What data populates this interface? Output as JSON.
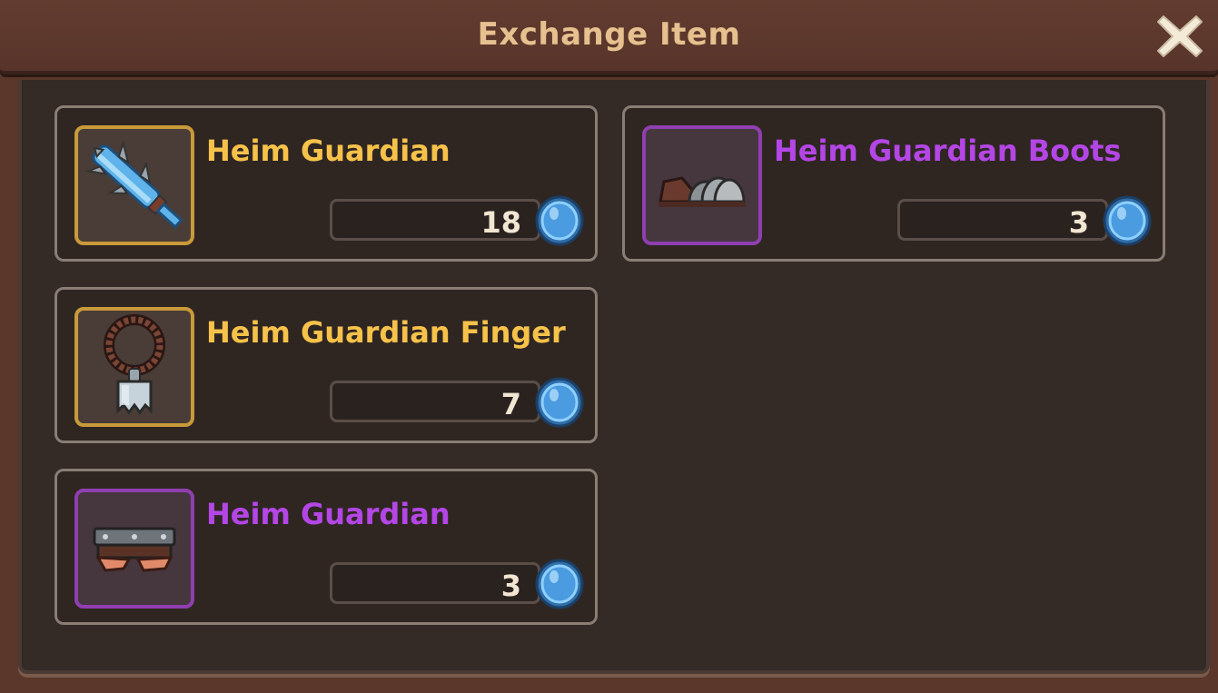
{
  "window": {
    "title": "Exchange Item",
    "close_icon": "close-x-icon"
  },
  "colors": {
    "legendary": "#f7c24a",
    "epic": "#b446e6",
    "price_text": "#f2e6d2",
    "title_text": "#e6c08e"
  },
  "items": [
    {
      "name": "Heim Guardian",
      "price": "18",
      "rarity": "legendary",
      "icon": "crystal-club-icon",
      "currency_icon": "blue-coin-icon"
    },
    {
      "name": "Heim Guardian Boots",
      "price": "3",
      "rarity": "epic",
      "icon": "armored-boots-icon",
      "currency_icon": "blue-coin-icon"
    },
    {
      "name": "Heim Guardian Finger",
      "price": "7",
      "rarity": "legendary",
      "icon": "ring-pendant-icon",
      "currency_icon": "blue-coin-icon"
    },
    {
      "name": "Heim Guardian",
      "price": "3",
      "rarity": "epic",
      "icon": "armored-gloves-icon",
      "currency_icon": "blue-coin-icon"
    }
  ]
}
